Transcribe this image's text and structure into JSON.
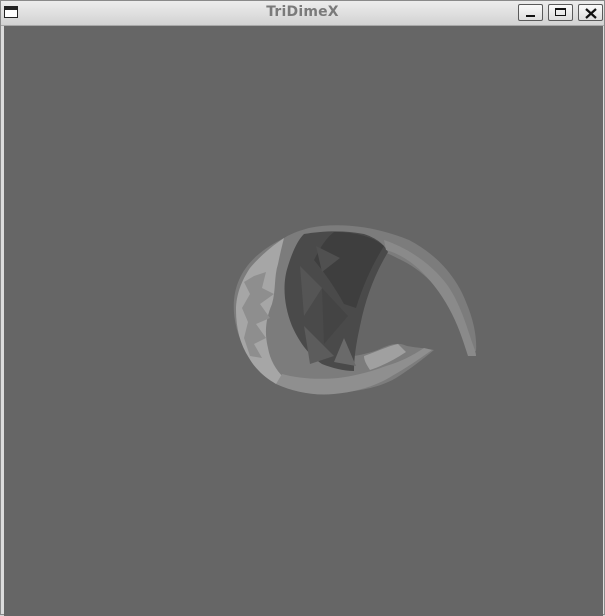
{
  "window": {
    "title": "TriDimeX",
    "menu_icon": "window-menu-icon",
    "controls": {
      "minimize_icon": "minimize-icon",
      "maximize_icon": "maximize-icon",
      "close_icon": "close-icon"
    }
  },
  "viewport": {
    "background_color": "#666666",
    "model_icon": "3d-mesh-model",
    "model_colors": {
      "light": "#a6a6a6",
      "mid": "#7c7c7c",
      "dark": "#4a4a4a",
      "shadow": "#3e3e3e"
    }
  }
}
